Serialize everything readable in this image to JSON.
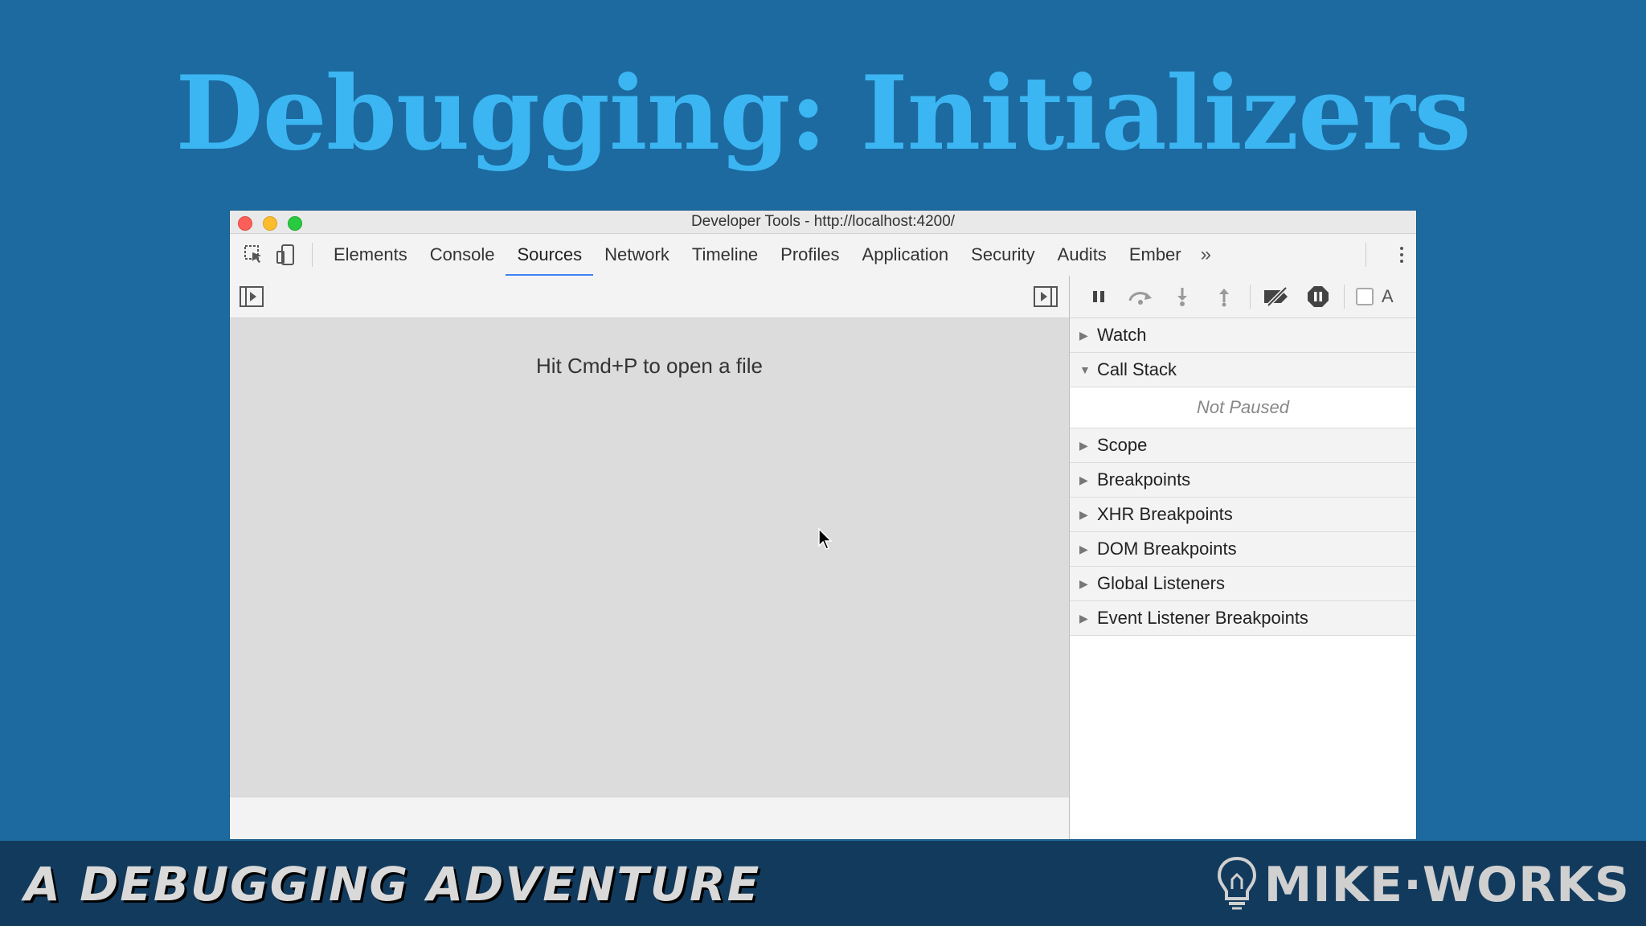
{
  "slide": {
    "title": "Debugging: Initializers"
  },
  "window": {
    "title": "Developer Tools - http://localhost:4200/"
  },
  "tabs": [
    {
      "label": "Elements"
    },
    {
      "label": "Console"
    },
    {
      "label": "Sources",
      "active": true
    },
    {
      "label": "Network"
    },
    {
      "label": "Timeline"
    },
    {
      "label": "Profiles"
    },
    {
      "label": "Application"
    },
    {
      "label": "Security"
    },
    {
      "label": "Audits"
    },
    {
      "label": "Ember"
    }
  ],
  "more_tabs": "»",
  "editor": {
    "hint": "Hit Cmd+P to open a file"
  },
  "debugger": {
    "pause_on_exceptions_label": "A",
    "sections": [
      {
        "label": "Watch",
        "expanded": false
      },
      {
        "label": "Call Stack",
        "expanded": true
      },
      {
        "label": "Scope",
        "expanded": false
      },
      {
        "label": "Breakpoints",
        "expanded": false
      },
      {
        "label": "XHR Breakpoints",
        "expanded": false
      },
      {
        "label": "DOM Breakpoints",
        "expanded": false
      },
      {
        "label": "Global Listeners",
        "expanded": false
      },
      {
        "label": "Event Listener Breakpoints",
        "expanded": false
      }
    ],
    "call_stack_status": "Not Paused"
  },
  "footer": {
    "tagline": "A DEBUGGING ADVENTURE",
    "brand": "MIKE·WORKS"
  },
  "colors": {
    "accent": "#3e82f7",
    "title": "#3bb6f2",
    "background": "#1c6aa0"
  }
}
